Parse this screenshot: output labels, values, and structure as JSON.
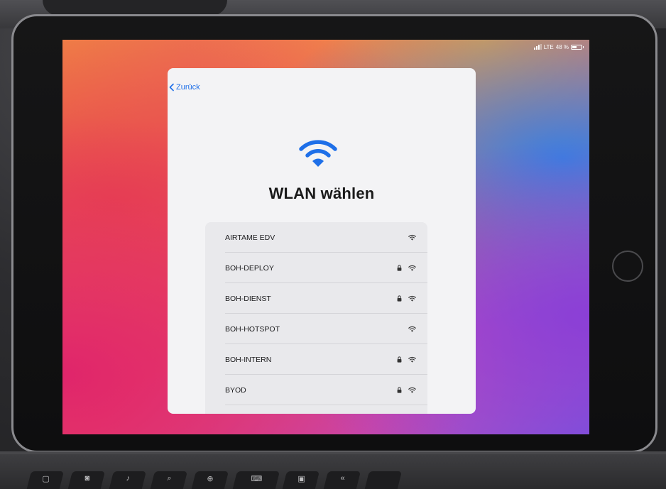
{
  "device": {
    "status_bar": {
      "carrier": "LTE",
      "battery_text": "48 %",
      "battery_level": 0.48
    }
  },
  "sheet": {
    "back_label": "Zurück",
    "title": "WLAN wählen",
    "networks": [
      {
        "name": "AIRTAME EDV",
        "secured": false
      },
      {
        "name": "BOH-DEPLOY",
        "secured": true
      },
      {
        "name": "BOH-DIENST",
        "secured": true
      },
      {
        "name": "BOH-HOTSPOT",
        "secured": false
      },
      {
        "name": "BOH-INTERN",
        "secured": true
      },
      {
        "name": "BYOD",
        "secured": true
      }
    ],
    "accent_color": "#1e6fe8"
  },
  "keyboard": {
    "keys": [
      "",
      "",
      "",
      "",
      "",
      "",
      "",
      "",
      ""
    ]
  }
}
